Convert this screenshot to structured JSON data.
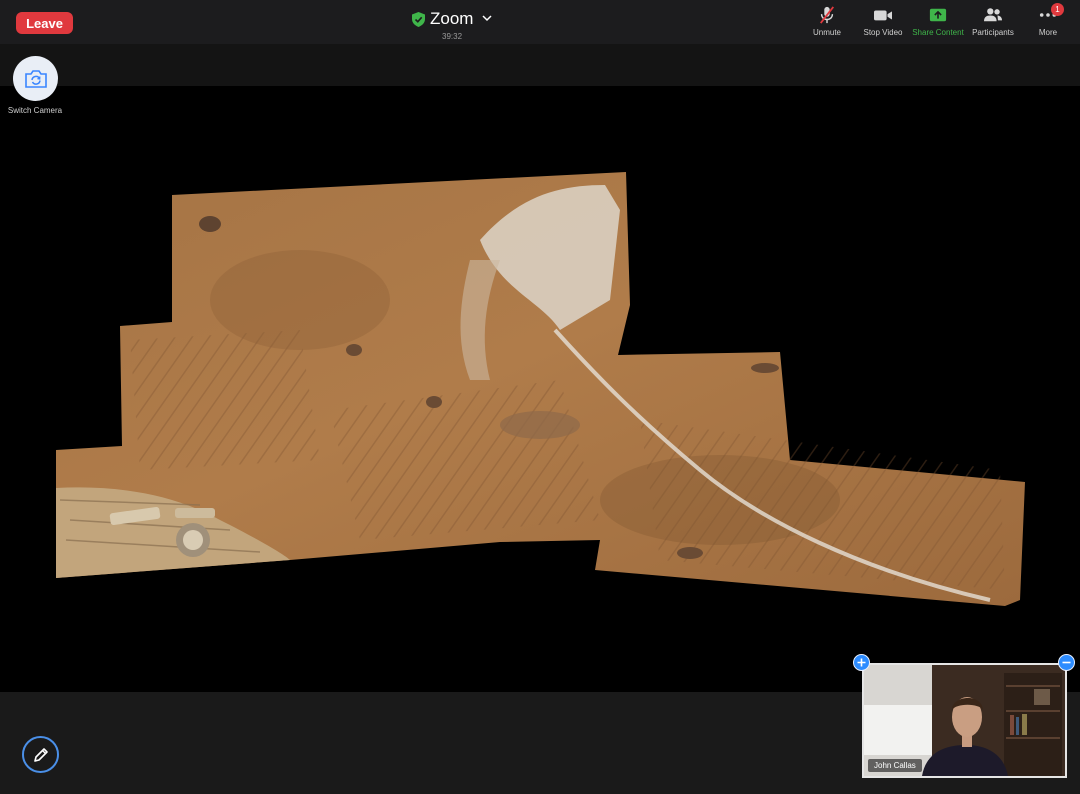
{
  "header": {
    "leave_label": "Leave",
    "title": "Zoom",
    "timer": "39:32",
    "toolbar": [
      {
        "label": "Unmute",
        "icon": "mic-muted-icon"
      },
      {
        "label": "Stop Video",
        "icon": "video-camera-icon"
      },
      {
        "label": "Share Content",
        "icon": "share-upload-icon"
      },
      {
        "label": "Participants",
        "icon": "participants-icon"
      },
      {
        "label": "More",
        "icon": "more-dots-icon",
        "badge": "1"
      }
    ]
  },
  "switch_camera": {
    "label": "Switch Camera",
    "icon": "camera-rotate-icon"
  },
  "self_view": {
    "name": "John Callas"
  },
  "colors": {
    "leave_red": "#e0393e",
    "share_green": "#3fb54a",
    "accent_blue": "#2d8cff"
  }
}
